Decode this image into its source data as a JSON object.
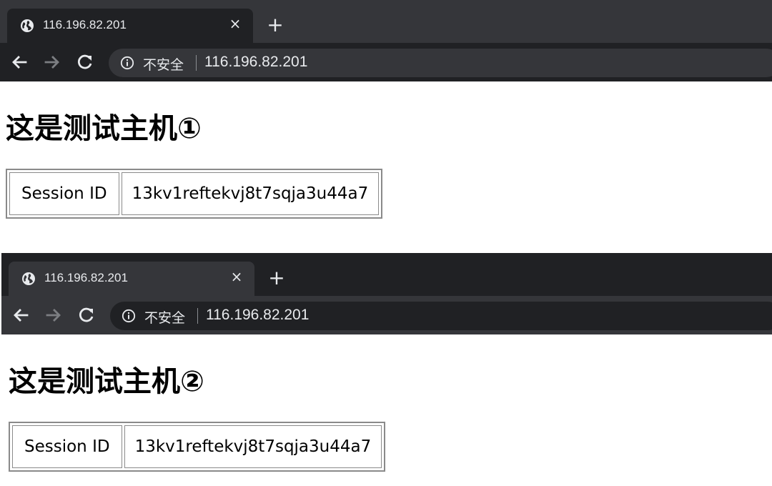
{
  "screenshots": [
    {
      "browser": {
        "tab_title": "116.196.82.201",
        "tab_close_label": "×",
        "new_tab_label": "+",
        "security_label": "不安全",
        "url": "116.196.82.201"
      },
      "page": {
        "heading": "这是测试主机①",
        "table": {
          "label": "Session ID",
          "value": "13kv1reftekvj8t7sqja3u44a7"
        }
      }
    },
    {
      "browser": {
        "tab_title": "116.196.82.201",
        "tab_close_label": "×",
        "new_tab_label": "+",
        "security_label": "不安全",
        "url": "116.196.82.201"
      },
      "page": {
        "heading": "这是测试主机②",
        "table": {
          "label": "Session ID",
          "value": "13kv1reftekvj8t7sqja3u44a7"
        }
      }
    }
  ],
  "icons": {
    "globe": "globe-icon",
    "back": "arrow-left-icon",
    "forward": "arrow-right-icon",
    "reload": "reload-icon",
    "info": "info-icon",
    "close": "close-icon",
    "plus": "plus-icon"
  },
  "colors": {
    "chrome_dark": "#202124",
    "chrome_mid": "#35363a",
    "chrome_text": "#e8eaed",
    "forward_disabled": "#7c7e82",
    "page_bg": "#ffffff",
    "table_border": "#8a8a8a"
  }
}
